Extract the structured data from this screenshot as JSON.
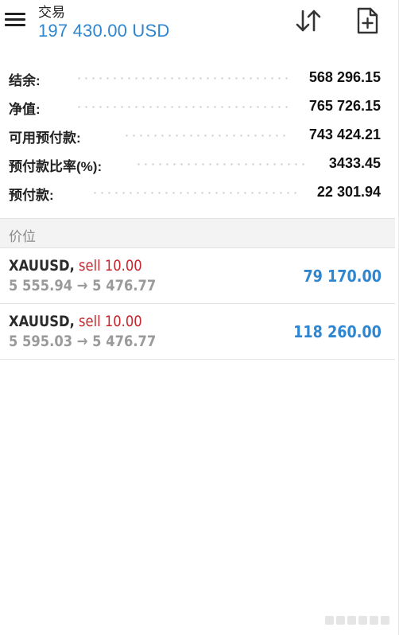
{
  "header": {
    "title": "交易",
    "balance": "197 430.00 USD",
    "icons": {
      "menu": "menu-icon",
      "sort": "sort-icon",
      "add_order": "add-document-icon"
    }
  },
  "summary": [
    {
      "label": "结余:",
      "value": "568 296.15"
    },
    {
      "label": "净值:",
      "value": "765 726.15"
    },
    {
      "label": "可用预付款:",
      "value": "743 424.21"
    },
    {
      "label": "预付款比率(%):",
      "value": "3433.45"
    },
    {
      "label": "预付款:",
      "value": "22 301.94"
    }
  ],
  "section": {
    "title": "价位"
  },
  "positions": [
    {
      "symbol": "XAUUSD",
      "separator": ",",
      "side": "sell 10.00",
      "prices": "5 555.94 → 5 476.77",
      "profit": "79 170.00"
    },
    {
      "symbol": "XAUUSD",
      "separator": ",",
      "side": "sell 10.00",
      "prices": "5 595.03 → 5 476.77",
      "profit": "118 260.00"
    }
  ],
  "colors": {
    "accent": "#2f86d0",
    "sell": "#c8262d",
    "muted": "#9a9a9a"
  }
}
